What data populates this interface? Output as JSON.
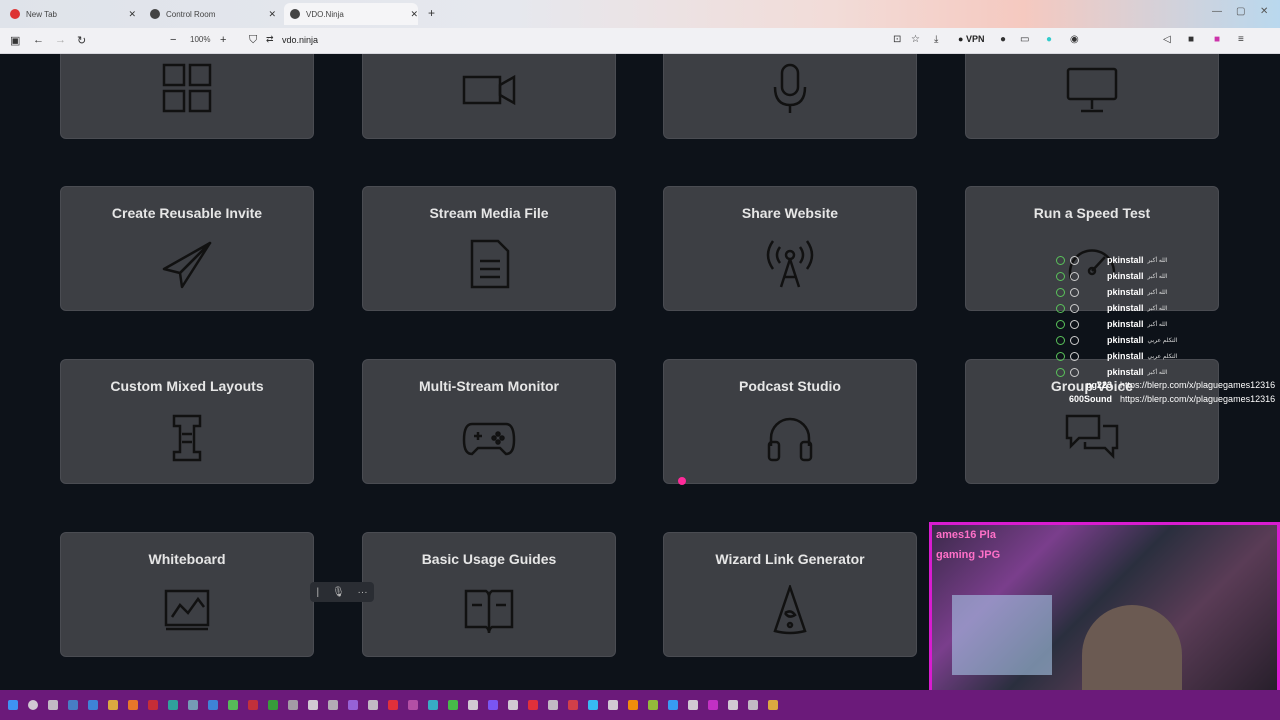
{
  "browser": {
    "tabs": [
      {
        "label": "New Tab",
        "color": "#d33"
      },
      {
        "label": "Control Room",
        "color": "#333"
      },
      {
        "label": "VDO.Ninja",
        "color": "#333"
      }
    ],
    "zoom": "100%",
    "url": "vdo.ninja",
    "vpn_label": "VPN"
  },
  "cards": [
    {
      "title": "",
      "icon": "grid-icon"
    },
    {
      "title": "",
      "icon": "video-camera-icon"
    },
    {
      "title": "",
      "icon": "microphone-icon"
    },
    {
      "title": "",
      "icon": "monitor-icon"
    },
    {
      "title": "Create Reusable Invite",
      "icon": "paper-plane-icon"
    },
    {
      "title": "Stream Media File",
      "icon": "document-icon"
    },
    {
      "title": "Share Website",
      "icon": "broadcast-icon"
    },
    {
      "title": "Run a Speed Test",
      "icon": "speedometer-icon"
    },
    {
      "title": "Custom Mixed Layouts",
      "icon": "layout-icon"
    },
    {
      "title": "Multi-Stream Monitor",
      "icon": "gamepad-icon"
    },
    {
      "title": "Podcast Studio",
      "icon": "headphones-icon"
    },
    {
      "title": "Group Voice",
      "icon": "chat-bubbles-icon"
    },
    {
      "title": "Whiteboard",
      "icon": "whiteboard-icon"
    },
    {
      "title": "Basic Usage Guides",
      "icon": "book-icon"
    },
    {
      "title": "Wizard Link Generator",
      "icon": "wizard-hat-icon"
    }
  ],
  "chat": {
    "rows": [
      {
        "name": "pkinstall",
        "msg": "الله أكبر"
      },
      {
        "name": "pkinstall",
        "msg": "الله أكبر"
      },
      {
        "name": "pkinstall",
        "msg": "الله أكبر"
      },
      {
        "name": "pkinstall",
        "msg": "الله أكبر"
      },
      {
        "name": "pkinstall",
        "msg": "الله أكبر"
      },
      {
        "name": "pkinstall",
        "msg": "التكلم عربي"
      },
      {
        "name": "pkinstall",
        "msg": "التكلم عربي"
      },
      {
        "name": "pkinstall",
        "msg": "الله أكبر"
      }
    ],
    "links": [
      {
        "name": "pg223",
        "url": "https://blerp.com/x/plaguegames12316"
      },
      {
        "name": "600Sound",
        "url": "https://blerp.com/x/plaguegames12316"
      }
    ]
  },
  "cam": {
    "sticker1": "ames16 Pla",
    "sticker2": "gaming JPG"
  },
  "colors": {
    "card_bg": "#3d3f44",
    "page_bg": "#0d1219",
    "accent": "#d81cd0",
    "taskbar": "#6b1a7a"
  }
}
